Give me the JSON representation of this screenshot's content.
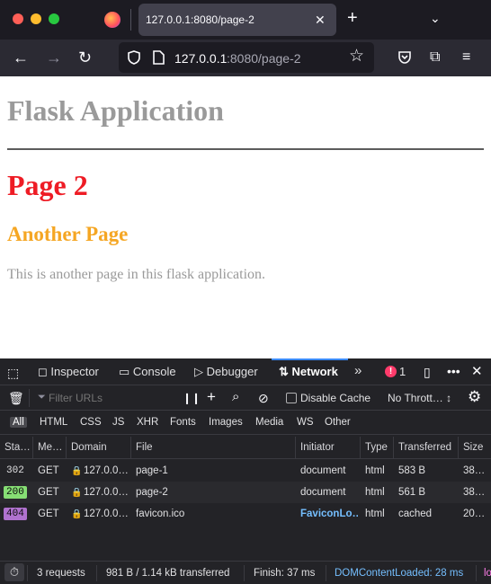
{
  "browser": {
    "tab_title": "127.0.0.1:8080/page-2",
    "url_host": "127.0.0.1",
    "url_rest": ":8080/page-2",
    "colors": {
      "close": "#ff5f57",
      "minimize": "#febc2e",
      "maximize": "#28c840"
    }
  },
  "page": {
    "heading": "Flask Application",
    "title": "Page 2",
    "subtitle": "Another Page",
    "paragraph": "This is another page in this flask application."
  },
  "devtools": {
    "tabs": {
      "inspector": "Inspector",
      "console": "Console",
      "debugger": "Debugger",
      "network": "Network"
    },
    "error_count": "1",
    "filter_placeholder": "Filter URLs",
    "disable_cache": "Disable Cache",
    "throttling": "No Thrott… ↕",
    "filter_types": [
      "All",
      "HTML",
      "CSS",
      "JS",
      "XHR",
      "Fonts",
      "Images",
      "Media",
      "WS",
      "Other"
    ],
    "columns": [
      "Sta…",
      "Me…",
      "Domain",
      "File",
      "Initiator",
      "Type",
      "Transferred",
      "Size"
    ],
    "requests": [
      {
        "status": "302",
        "method": "GET",
        "domain": "127.0.0…",
        "file": "page-1",
        "initiator": "document",
        "type": "html",
        "transferred": "583 B",
        "size": "38…"
      },
      {
        "status": "200",
        "method": "GET",
        "domain": "127.0.0…",
        "file": "page-2",
        "initiator": "document",
        "type": "html",
        "transferred": "561 B",
        "size": "38…"
      },
      {
        "status": "404",
        "method": "GET",
        "domain": "127.0.0…",
        "file": "favicon.ico",
        "initiator": "FaviconLo…",
        "type": "html",
        "transferred": "cached",
        "size": "20…"
      }
    ],
    "status": {
      "requests": "3 requests",
      "transferred": "981 B / 1.14 kB transferred",
      "finish": "Finish: 37 ms",
      "dcl": "DOMContentLoaded: 28 ms",
      "load": "lo"
    }
  }
}
